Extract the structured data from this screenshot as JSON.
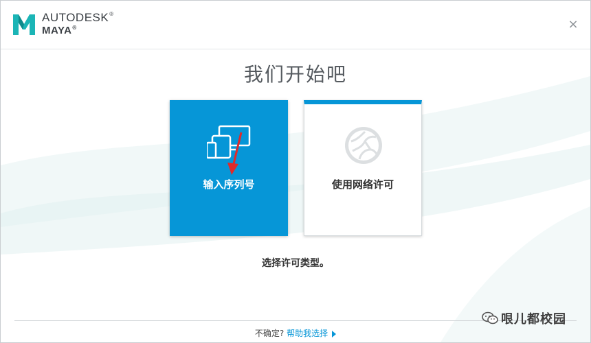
{
  "header": {
    "brand_line1": "AUTODESK",
    "brand_line2": "MAYA",
    "close_label": "×"
  },
  "main": {
    "title": "我们开始吧",
    "cards": [
      {
        "label": "输入序列号",
        "icon": "devices-icon"
      },
      {
        "label": "使用网络许可",
        "icon": "globe-icon"
      }
    ],
    "prompt": "选择许可类型。"
  },
  "footer": {
    "question": "不确定?",
    "help_link": "帮助我选择"
  },
  "watermark": {
    "text": "哏儿都校园"
  },
  "colors": {
    "accent": "#0696d7",
    "maya_logo": "#1bb5b6",
    "annotation_arrow": "#e02a2a"
  }
}
